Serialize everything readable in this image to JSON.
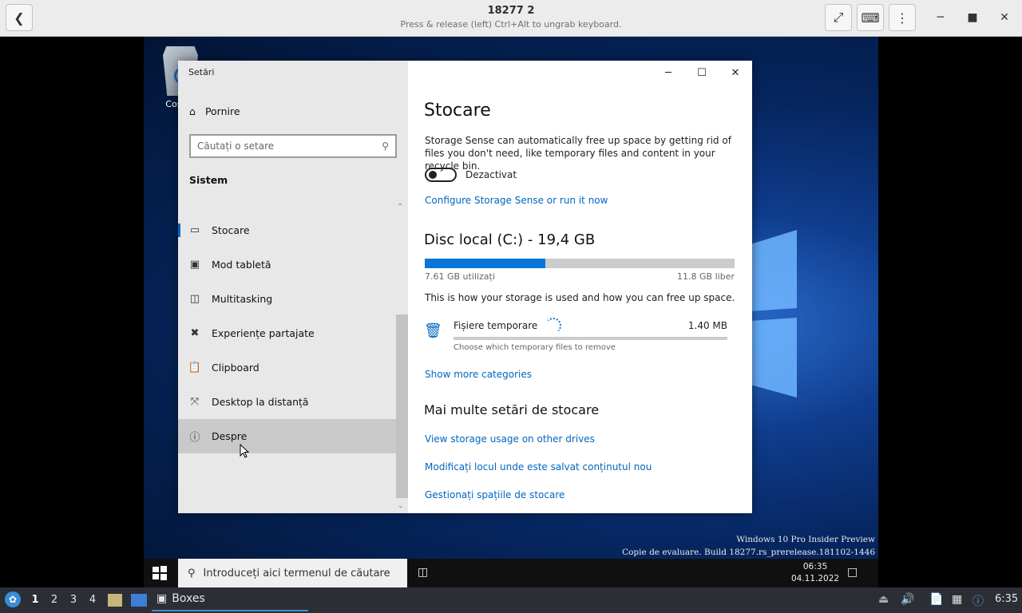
{
  "host": {
    "title": "18277 2",
    "subtitle": "Press & release (left) Ctrl+Alt to ungrab keyboard.",
    "workspaces": [
      "1",
      "2",
      "3",
      "4"
    ],
    "task_label": "Boxes",
    "time": "6:35"
  },
  "desktop": {
    "recycle_label": "Coș de"
  },
  "settings": {
    "app_title": "Setări",
    "home": "Pornire",
    "search_placeholder": "Căutați o setare",
    "section": "Sistem",
    "nav": [
      {
        "label": "Stocare"
      },
      {
        "label": "Mod tabletă"
      },
      {
        "label": "Multitasking"
      },
      {
        "label": "Experiențe partajate"
      },
      {
        "label": "Clipboard"
      },
      {
        "label": "Desktop la distanță"
      },
      {
        "label": "Despre"
      }
    ],
    "page_title": "Stocare",
    "description": "Storage Sense can automatically free up space by getting rid of files you don't need, like temporary files and content in your recycle bin.",
    "toggle_label": "Dezactivat",
    "configure_link": "Configure Storage Sense or run it now",
    "disk_title": "Disc local (C:) - 19,4 GB",
    "disk_used_fraction": 0.39,
    "used_label": "7.61 GB utilizați",
    "free_label": "11.8 GB liber",
    "usage_text": "This is how your storage is used and how you can free up space.",
    "category": {
      "name": "Fișiere temporare",
      "size": "1.40 MB",
      "hint": "Choose which temporary files to remove"
    },
    "more_link": "Show more categories",
    "more_title": "Mai multe setări de stocare",
    "links": [
      "View storage usage on other drives",
      "Modificați locul unde este salvat conținutul nou",
      "Gestionați spațiile de stocare"
    ]
  },
  "guest_taskbar": {
    "search_placeholder": "Introduceți aici termenul de căutare",
    "clock_time": "06:35",
    "clock_date": "04.11.2022"
  },
  "watermark": {
    "line1": "Windows 10 Pro Insider Preview",
    "line2": "Copie de evaluare. Build 18277.rs_prerelease.181102-1446"
  }
}
